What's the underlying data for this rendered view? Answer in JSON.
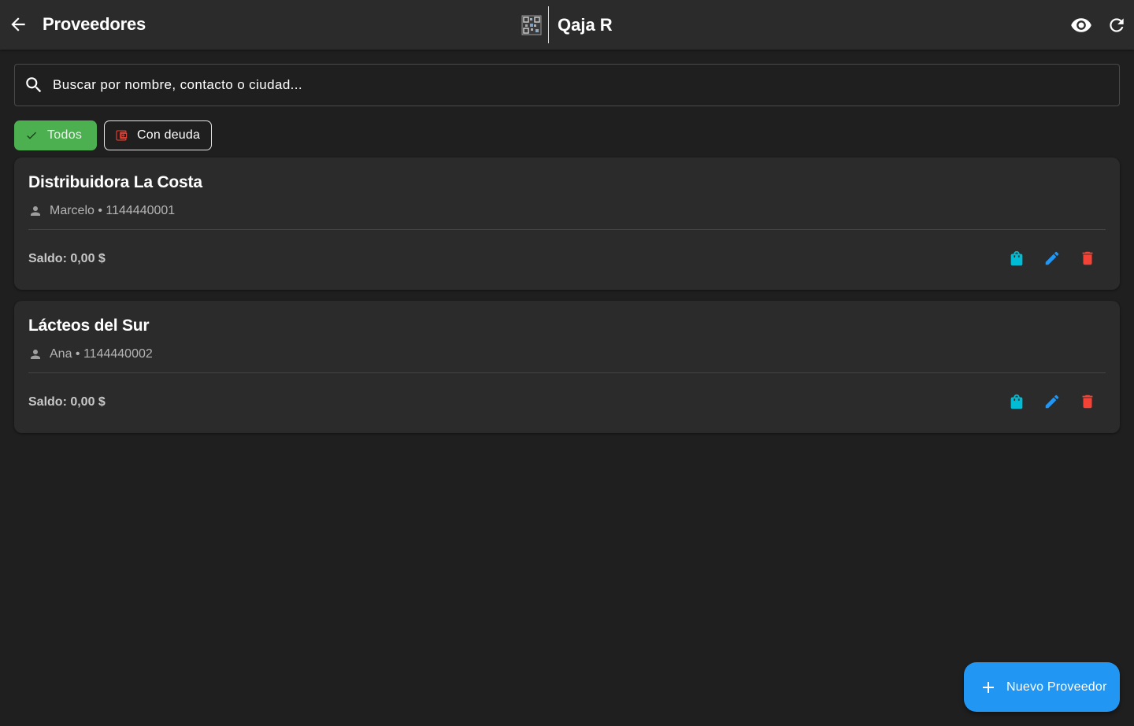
{
  "header": {
    "title": "Proveedores",
    "brand_name": "Qaja R",
    "icons": {
      "back": "arrow-back-icon",
      "brand_logo": "qr-code-icon",
      "visibility": "eye-icon",
      "refresh": "refresh-icon"
    }
  },
  "search": {
    "placeholder": "Buscar por nombre, contacto o ciudad...",
    "value": "",
    "icon": "search-icon"
  },
  "filters": [
    {
      "label": "Todos",
      "icon": "check-icon",
      "selected": true
    },
    {
      "label": "Con deuda",
      "icon": "wallet-icon",
      "selected": false
    }
  ],
  "suppliers": [
    {
      "name": "Distribuidora La Costa",
      "contact": "Marcelo • 1144440001",
      "balance": "Saldo: 0,00 $"
    },
    {
      "name": "Lácteos del Sur",
      "contact": "Ana • 1144440002",
      "balance": "Saldo: 0,00 $"
    }
  ],
  "card_actions": {
    "purchase": "shopping-bag-icon",
    "edit": "pencil-icon",
    "delete": "trash-icon"
  },
  "fab": {
    "label": "Nuevo Proveedor",
    "icon": "plus-icon"
  },
  "colors": {
    "background": "#1f1f1f",
    "surface": "#2b2b2b",
    "filter_selected": "#4caf50",
    "purchase_icon": "#00bcd4",
    "edit_icon": "#2196f3",
    "delete_icon": "#f44336",
    "fab": "#2196f3",
    "debt_icon": "#f44336"
  }
}
